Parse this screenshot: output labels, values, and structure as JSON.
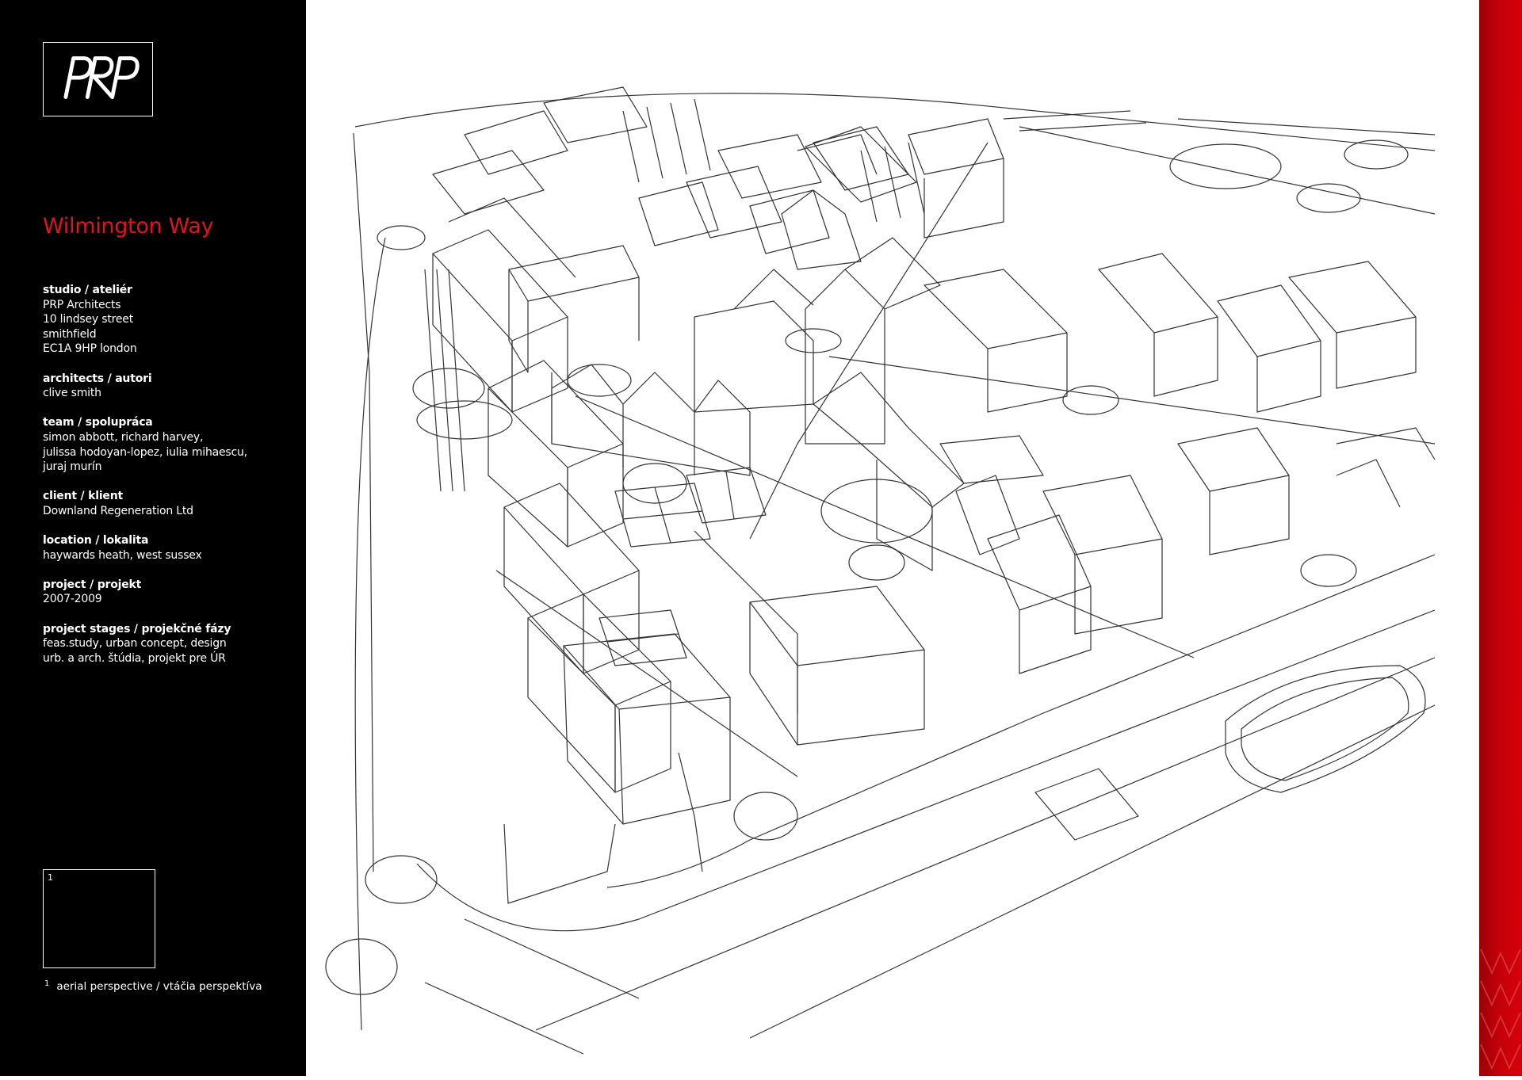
{
  "logo": {
    "text": "PRP"
  },
  "project_title": "Wilmington Way",
  "info_blocks": [
    {
      "label": "studio / ateliér",
      "lines": [
        "PRP Architects",
        "10 lindsey street",
        "smithfield",
        "EC1A 9HP london"
      ]
    },
    {
      "label": "architects / autori",
      "lines": [
        "clive smith"
      ]
    },
    {
      "label": "team / spolupráca",
      "lines": [
        "simon abbott, richard harvey,",
        "julissa hodoyan-lopez, iulia mihaescu,",
        "juraj murín"
      ]
    },
    {
      "label": "client / klient",
      "lines": [
        "Downland Regeneration Ltd"
      ]
    },
    {
      "label": "location / lokalita",
      "lines": [
        "haywards heath, west sussex"
      ]
    },
    {
      "label": "project / projekt",
      "lines": [
        "2007-2009"
      ]
    },
    {
      "label": "project stages / projekčné fázy",
      "lines": [
        "feas.study, urban concept, design",
        "urb. a arch. štúdia, projekt pre ÚR"
      ]
    }
  ],
  "thumbnail": {
    "number": "1"
  },
  "caption": {
    "number": "1",
    "text": "aerial perspective / vtáčia perspektíva"
  },
  "colors": {
    "accent_red": "#e1131b",
    "sidebar_bg": "#000000",
    "line_color": "#333333"
  }
}
